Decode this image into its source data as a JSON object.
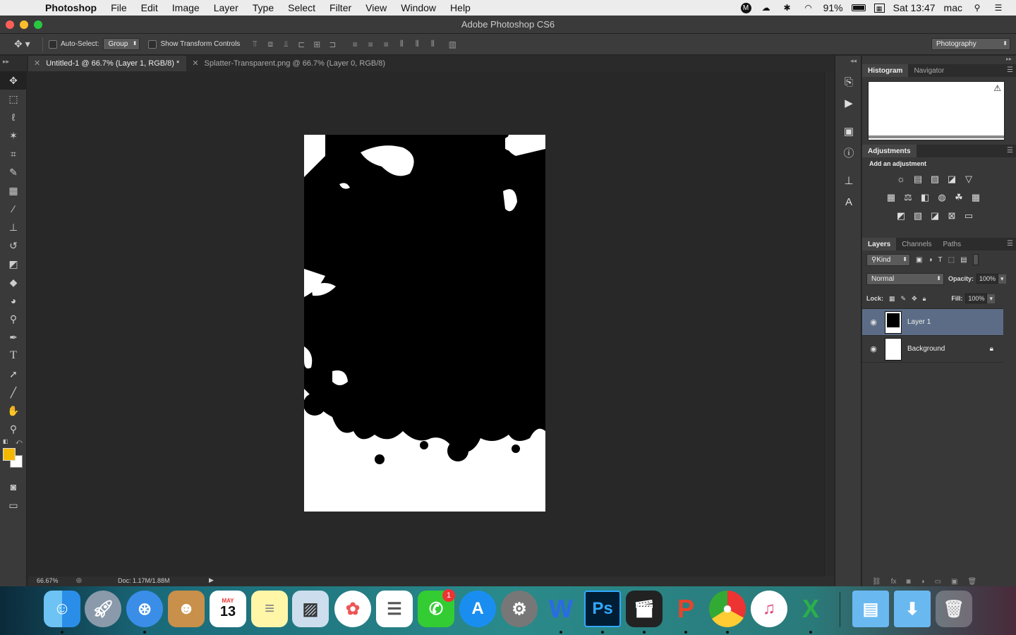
{
  "menubar": {
    "app_name": "Photoshop",
    "items": [
      "File",
      "Edit",
      "Image",
      "Layer",
      "Type",
      "Select",
      "Filter",
      "View",
      "Window",
      "Help"
    ],
    "battery": "91%",
    "clock": "Sat 13:47",
    "user": "mac"
  },
  "window": {
    "title": "Adobe Photoshop CS6"
  },
  "options": {
    "auto_select_label": "Auto-Select:",
    "auto_select_value": "Group",
    "transform_label": "Show Transform Controls",
    "workspace": "Photography"
  },
  "tabs": [
    {
      "label": "Untitled-1 @ 66.7% (Layer 1, RGB/8) *"
    },
    {
      "label": "Splatter-Transparent.png @ 66.7% (Layer 0, RGB/8)"
    }
  ],
  "status": {
    "zoom": "66.67%",
    "doc": "Doc: 1.17M/1.88M"
  },
  "colors": {
    "foreground": "#f5b800",
    "background": "#ffffff",
    "selection": "#5c6c86"
  },
  "panels": {
    "histogram_tabs": [
      "Histogram",
      "Navigator"
    ],
    "adjustments_title": "Adjustments",
    "add_adjustment": "Add an adjustment",
    "layers_tabs": [
      "Layers",
      "Channels",
      "Paths"
    ],
    "kind_label": "Kind",
    "blend_mode": "Normal",
    "opacity_label": "Opacity:",
    "opacity_value": "100%",
    "lock_label": "Lock:",
    "fill_label": "Fill:",
    "fill_value": "100%",
    "layers": [
      {
        "name": "Layer 1",
        "selected": true
      },
      {
        "name": "Background",
        "selected": false
      }
    ]
  },
  "dock": {
    "calendar_month": "MAY",
    "calendar_day": "13",
    "facetime_badge": "1",
    "apps": [
      "Finder",
      "Launchpad",
      "Safari",
      "Contacts",
      "Calendar",
      "Notes",
      "Preview",
      "Photos",
      "Reminders",
      "FaceTime",
      "App Store",
      "System Preferences",
      "Word",
      "Photoshop",
      "Final Cut Pro",
      "PowerPoint",
      "Chrome",
      "iTunes",
      "Excel",
      "Documents",
      "Downloads",
      "Trash"
    ]
  }
}
